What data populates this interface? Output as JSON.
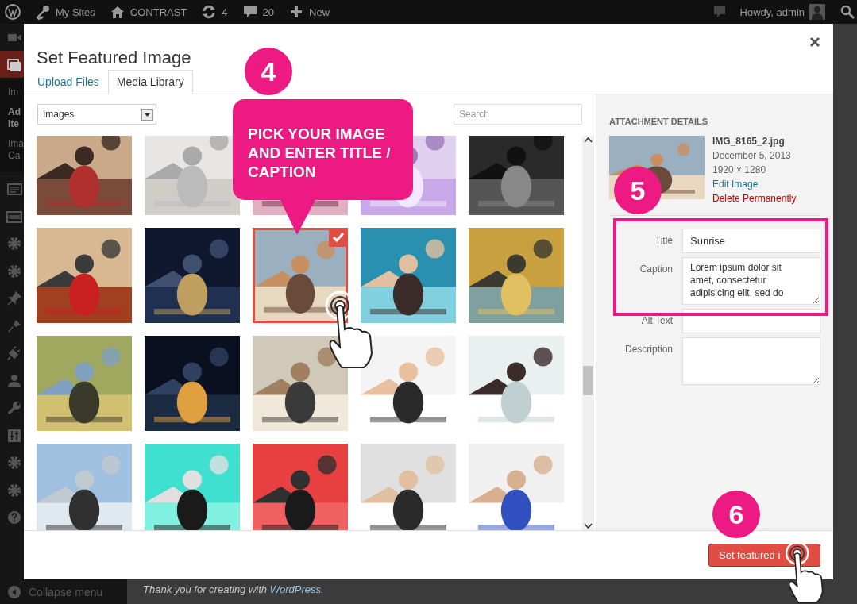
{
  "admin_bar": {
    "items": [
      {
        "kind": "logo"
      },
      {
        "kind": "sites",
        "label": "My Sites"
      },
      {
        "kind": "home",
        "label": "CONTRAST"
      },
      {
        "kind": "updates",
        "label": "4"
      },
      {
        "kind": "comments",
        "label": "20"
      },
      {
        "kind": "new",
        "label": "New"
      }
    ],
    "greeting": "Howdy, admin"
  },
  "sidebar": {
    "menu_top": [
      {
        "kind": "video",
        "selected": false
      },
      {
        "kind": "media",
        "selected": true
      }
    ],
    "submenu": [
      {
        "lines": [
          "Im"
        ],
        "current": false
      },
      {
        "lines": [
          "Ad",
          "Ite"
        ],
        "current": true
      },
      {
        "lines": [
          "Ima",
          "Ca"
        ],
        "current": false
      }
    ],
    "menu": [
      {
        "kind": "list",
        "selected": false
      },
      {
        "kind": "layout",
        "selected": false
      },
      {
        "kind": "gear",
        "selected": false
      },
      {
        "kind": "gear",
        "selected": false
      },
      {
        "kind": "pin",
        "selected": false
      },
      {
        "kind": "brush",
        "selected": false
      },
      {
        "kind": "plug",
        "selected": false
      },
      {
        "kind": "user",
        "selected": false
      },
      {
        "kind": "wrench",
        "selected": false
      },
      {
        "kind": "sliders",
        "selected": false
      },
      {
        "kind": "gear",
        "selected": false
      },
      {
        "kind": "gear",
        "selected": false
      },
      {
        "kind": "help",
        "selected": false
      }
    ],
    "collapse": "Collapse menu"
  },
  "footer": {
    "text": "Thank you for creating with ",
    "link": "WordPress",
    "after": "."
  },
  "modal": {
    "title": "Set Featured Image",
    "tabs": [
      {
        "label": "Upload Files",
        "selected": false
      },
      {
        "label": "Media Library",
        "selected": true
      }
    ],
    "filter": {
      "value": "Images"
    },
    "search": {
      "placeholder": "Search"
    },
    "grid": [
      {
        "kind": "picture",
        "selected": false
      },
      {
        "kind": "picture",
        "selected": false
      },
      {
        "kind": "picture",
        "selected": false
      },
      {
        "kind": "picture",
        "selected": false
      },
      {
        "kind": "picture",
        "selected": false
      },
      {
        "kind": "picture",
        "selected": false
      },
      {
        "kind": "picture",
        "selected": false
      },
      {
        "kind": "picture",
        "selected": true
      },
      {
        "kind": "picture",
        "selected": false
      },
      {
        "kind": "picture",
        "selected": false
      },
      {
        "kind": "picture",
        "selected": false
      },
      {
        "kind": "picture",
        "selected": false
      },
      {
        "kind": "picture",
        "selected": false
      },
      {
        "kind": "picture",
        "selected": false
      },
      {
        "kind": "picture",
        "selected": false
      },
      {
        "kind": "picture",
        "selected": false
      },
      {
        "kind": "picture",
        "selected": false
      },
      {
        "kind": "picture",
        "selected": false
      },
      {
        "kind": "picture",
        "selected": false
      },
      {
        "kind": "picture",
        "selected": false
      }
    ],
    "details": {
      "heading": "ATTACHMENT DETAILS",
      "thumbnail": {
        "kind": "picture"
      },
      "filename": "IMG_8165_2.jpg",
      "date": "December 5, 2013",
      "dimensions": "1920 × 1280",
      "edit_link": "Edit Image",
      "delete_link": "Delete Permanently",
      "fields": [
        {
          "label": "Title",
          "kind": "input",
          "value": "Sunrise"
        },
        {
          "label": "Caption",
          "kind": "textarea",
          "value": "Lorem ipsum dolor sit amet, consectetur adipisicing elit, sed do"
        },
        {
          "label": "Alt Text",
          "kind": "input"
        },
        {
          "label": "Description",
          "kind": "textarea"
        }
      ]
    },
    "primary_button": "Set featured i"
  },
  "annotations": {
    "steps": [
      "4",
      "5",
      "6"
    ],
    "callout": "PICK YOUR IMAGE AND ENTER TITLE / CAPTION"
  }
}
